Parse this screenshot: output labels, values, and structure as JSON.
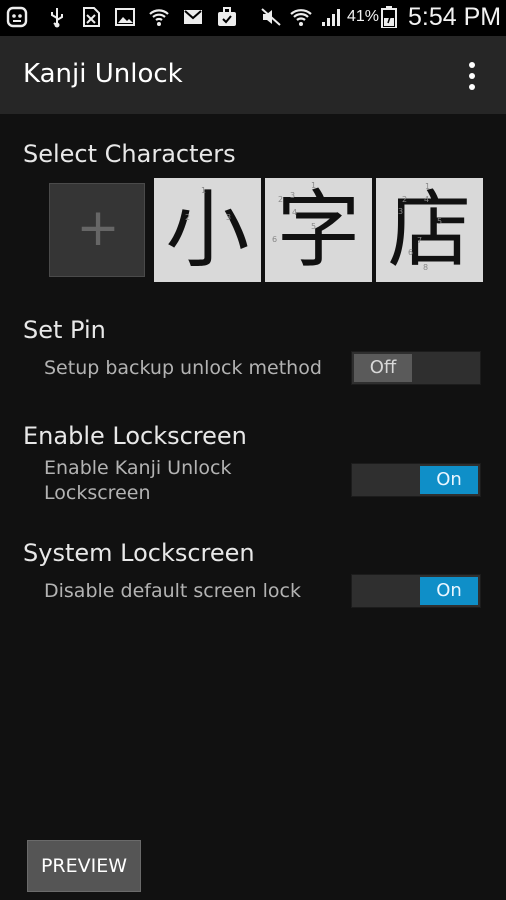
{
  "status_bar": {
    "battery_percent": "41%",
    "time": "5:54 PM",
    "icons": [
      "chat-icon",
      "usb-icon",
      "no-sim-icon",
      "image-icon",
      "wifi-hotspot-icon",
      "gmail-icon",
      "briefcase-icon",
      "mute-icon",
      "wifi-icon",
      "signal-icon",
      "battery-icon"
    ]
  },
  "app_bar": {
    "title": "Kanji Unlock",
    "menu_icon": "overflow-menu-icon"
  },
  "select_characters": {
    "title": "Select Characters",
    "add_icon": "plus-icon",
    "add_symbol": "+",
    "characters": [
      {
        "glyph": "小",
        "stroke_numbers": [
          "1",
          "2",
          "3"
        ]
      },
      {
        "glyph": "字",
        "stroke_numbers": [
          "1",
          "2",
          "3",
          "4",
          "5",
          "6"
        ]
      },
      {
        "glyph": "店",
        "stroke_numbers": [
          "1",
          "2",
          "3",
          "4",
          "5",
          "6",
          "7",
          "8"
        ]
      }
    ]
  },
  "set_pin": {
    "title": "Set Pin",
    "subtitle": "Setup backup unlock method",
    "toggle_label": "Off",
    "toggle_on": false
  },
  "enable_lockscreen": {
    "title": "Enable Lockscreen",
    "subtitle_line1": "Enable Kanji Unlock",
    "subtitle_line2": "Lockscreen",
    "toggle_label": "On",
    "toggle_on": true
  },
  "system_lockscreen": {
    "title": "System Lockscreen",
    "subtitle": "Disable default screen lock",
    "toggle_label": "On",
    "toggle_on": true
  },
  "preview_button": {
    "label": "PREVIEW"
  },
  "colors": {
    "background": "#111111",
    "app_bar": "#262626",
    "toggle_on": "#0f8fc8",
    "toggle_off": "#5a5a5a"
  }
}
